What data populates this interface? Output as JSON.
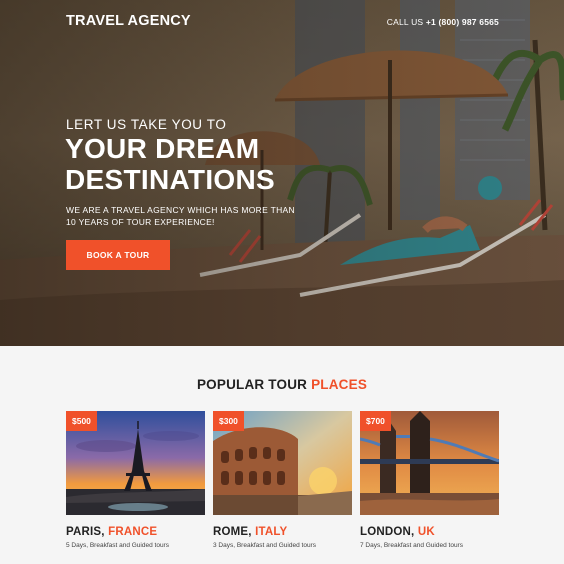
{
  "header": {
    "brand": "TRAVEL AGENCY",
    "call_label": "CALL US",
    "phone": "+1 (800) 987 6565"
  },
  "hero": {
    "tagline": "LERT US TAKE YOU TO",
    "headline_line1": "YOUR DREAM",
    "headline_line2": "DESTINATIONS",
    "subtitle": "WE ARE A TRAVEL AGENCY WHICH HAS MORE THAN 10 YEARS OF TOUR EXPERIENCE!",
    "cta_label": "BOOK A TOUR"
  },
  "tours": {
    "title_main": "POPULAR TOUR",
    "title_accent": "PLACES",
    "items": [
      {
        "price": "$500",
        "city": "PARIS,",
        "country": "FRANCE",
        "details": "5 Days, Breakfast and Guided tours",
        "photo_icon": "eiffel-tower"
      },
      {
        "price": "$300",
        "city": "ROME,",
        "country": "ITALY",
        "details": "3 Days, Breakfast and Guided tours",
        "photo_icon": "colosseum"
      },
      {
        "price": "$700",
        "city": "LONDON,",
        "country": "UK",
        "details": "7 Days, Breakfast and Guided tours",
        "photo_icon": "tower-bridge"
      }
    ]
  },
  "colors": {
    "accent": "#f0512a",
    "text_dark": "#222222",
    "section_bg": "#f5f5f5"
  }
}
